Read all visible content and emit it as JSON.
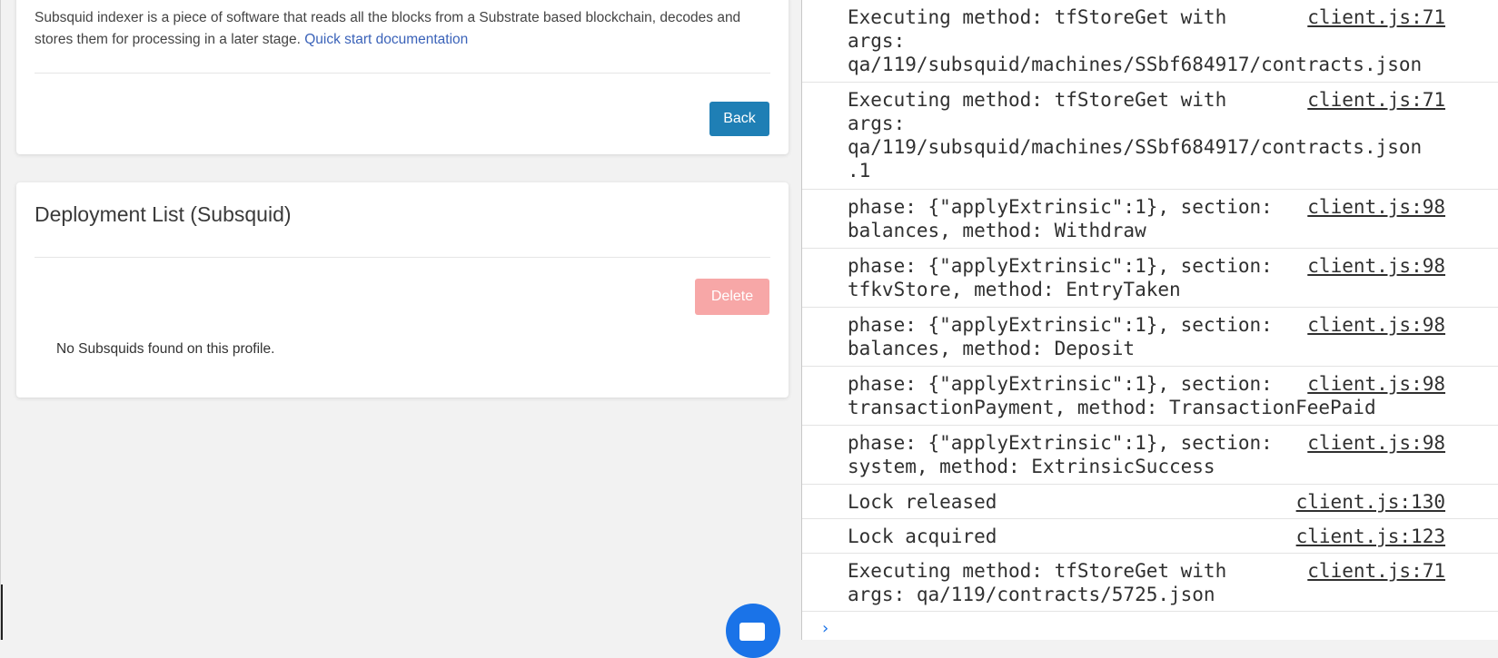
{
  "page": {
    "description_text": "Subsquid indexer is a piece of software that reads all the blocks from a Substrate based blockchain, decodes and stores them for processing in a later stage. ",
    "description_link": "Quick start documentation",
    "back_label": "Back",
    "list_title": "Deployment List (Subsquid)",
    "delete_label": "Delete",
    "empty_message": "No Subsquids found on this profile."
  },
  "console": {
    "entries": [
      {
        "message": "Executing method: tfStoreGet with\nargs:\nqa/119/subsquid/machines/SSbf684917/contracts.json",
        "source": "client.js:71"
      },
      {
        "message": "Executing method: tfStoreGet with\nargs:\nqa/119/subsquid/machines/SSbf684917/contracts.json\n.1",
        "source": "client.js:71"
      },
      {
        "message": "phase: {\"applyExtrinsic\":1}, section:\nbalances, method: Withdraw",
        "source": "client.js:98"
      },
      {
        "message": "phase: {\"applyExtrinsic\":1}, section:\ntfkvStore, method: EntryTaken",
        "source": "client.js:98"
      },
      {
        "message": "phase: {\"applyExtrinsic\":1}, section:\nbalances, method: Deposit",
        "source": "client.js:98"
      },
      {
        "message": "phase: {\"applyExtrinsic\":1}, section:\ntransactionPayment, method: TransactionFeePaid",
        "source": "client.js:98"
      },
      {
        "message": "phase: {\"applyExtrinsic\":1}, section:\nsystem, method: ExtrinsicSuccess",
        "source": "client.js:98"
      },
      {
        "message": "Lock released",
        "source": "client.js:130"
      },
      {
        "message": "Lock acquired",
        "source": "client.js:123"
      },
      {
        "message": "Executing method: tfStoreGet with\nargs: qa/119/contracts/5725.json",
        "source": "client.js:71"
      }
    ],
    "prompt_symbol": "›"
  },
  "icons": {
    "fab": "chat-icon",
    "prompt": "chevron-right-icon"
  },
  "colors": {
    "back_button": "#1f7fb5",
    "delete_button_disabled": "#f7a7a7",
    "link": "#3b63b9",
    "fab": "#1a73e8"
  }
}
